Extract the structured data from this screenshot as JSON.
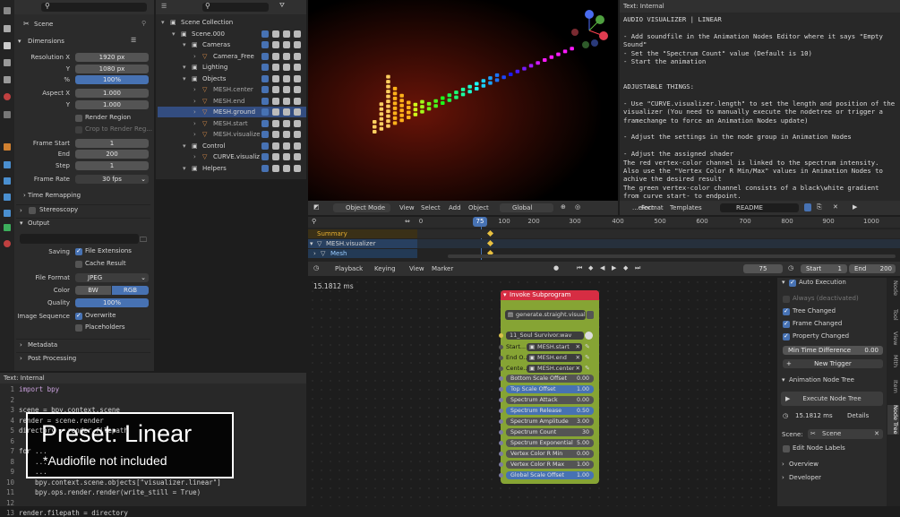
{
  "props": {
    "tab_title": "Scene",
    "dimensions": "Dimensions",
    "res_x_label": "Resolution X",
    "res_x": "1920 px",
    "res_y_label": "Y",
    "res_y": "1080 px",
    "pct_label": "%",
    "pct": "100%",
    "aspect_x_label": "Aspect X",
    "aspect_x": "1.000",
    "aspect_y_label": "Y",
    "aspect_y": "1.000",
    "render_region": "Render Region",
    "crop": "Crop to Render Reg...",
    "frame_start_label": "Frame Start",
    "frame_start": "1",
    "end_label": "End",
    "end": "200",
    "step_label": "Step",
    "step": "1",
    "frame_rate_label": "Frame Rate",
    "frame_rate": "30 fps",
    "time_remapping": "Time Remapping",
    "stereoscopy": "Stereoscopy",
    "output": "Output",
    "saving_label": "Saving",
    "file_ext": "File Extensions",
    "cache": "Cache Result",
    "file_format_label": "File Format",
    "file_format": "JPEG",
    "color_label": "Color",
    "bw": "BW",
    "rgb": "RGB",
    "quality_label": "Quality",
    "quality": "100%",
    "image_seq_label": "Image Sequence",
    "overwrite": "Overwrite",
    "placeholders": "Placeholders",
    "metadata": "Metadata",
    "post": "Post Processing"
  },
  "outliner": {
    "rows": [
      {
        "t": "Scene Collection",
        "i": 0
      },
      {
        "t": "Scene.000",
        "i": 1
      },
      {
        "t": "Cameras",
        "i": 2
      },
      {
        "t": "Camera_Free",
        "i": 3
      },
      {
        "t": "Lighting",
        "i": 2
      },
      {
        "t": "Objects",
        "i": 2
      },
      {
        "t": "MESH.center",
        "i": 3
      },
      {
        "t": "MESH.end",
        "i": 3
      },
      {
        "t": "MESH.ground",
        "i": 3
      },
      {
        "t": "MESH.start",
        "i": 3
      },
      {
        "t": "MESH.visualize",
        "i": 3
      },
      {
        "t": "Control",
        "i": 2
      },
      {
        "t": "CURVE.visualiz",
        "i": 3
      },
      {
        "t": "Helpers",
        "i": 2
      }
    ]
  },
  "textpanel": {
    "header": "Text: Internal",
    "lines": [
      "AUDIO VISUALIZER | LINEAR",
      "",
      "- Add soundfile in the Animation Nodes Editor where it says \"Empty",
      "Sound\"",
      "- Set the \"Spectrum Count\" value (Default is 10)",
      "- Start the animation",
      "",
      "",
      "ADJUSTABLE THINGS:",
      "",
      "- Use \"CURVE.visualizer.length\" to set the length and position of the",
      "visualizer (You need to manually execute the nodetree or trigger a",
      "framechange to force an Animation Nodes update)",
      "",
      "- Adjust the settings in the node group in Animation Nodes",
      "",
      "- Adjust the assigned shader",
      "The red vertex-color channel is linked to the spectrum intensity.",
      "Also use the \"Vertex Color R Min/Max\" values in Animation Nodes to",
      "achive the desired result",
      "The green vertex-color channel consists of a black\\white gradient",
      "from curve start- to endpoint."
    ],
    "menu": [
      "...elect",
      "Format",
      "Templates"
    ],
    "file": "README"
  },
  "viewport": {
    "mode": "Object Mode",
    "menu": [
      "View",
      "Select",
      "Add",
      "Object"
    ],
    "orient": "Global"
  },
  "timeline": {
    "ticks": [
      "0",
      "75",
      "100",
      "200",
      "300",
      "400",
      "500",
      "600",
      "700",
      "800",
      "900",
      "1000"
    ],
    "tracks": [
      "Summary",
      "MESH.visualizer",
      "Mesh"
    ],
    "menu": [
      "Playback",
      "Keying",
      "View",
      "Marker"
    ],
    "current": "75",
    "start_label": "Start",
    "start": "1",
    "end_label": "End",
    "end": "200"
  },
  "code": {
    "header": "Text: Internal",
    "lines": [
      {
        "n": "1",
        "t": "import bpy"
      },
      {
        "n": "2",
        "t": ""
      },
      {
        "n": "3",
        "t": "scene = bpy.context.scene"
      },
      {
        "n": "4",
        "t": "render = scene.render"
      },
      {
        "n": "5",
        "t": "directory = render.filepath"
      },
      {
        "n": "6",
        "t": ""
      },
      {
        "n": "7",
        "t": "for ..."
      },
      {
        "n": "8",
        "t": "    ..."
      },
      {
        "n": "9",
        "t": "    ..."
      },
      {
        "n": "10",
        "t": "    bpy.context.scene.objects[\"visualizer.linear\"]"
      },
      {
        "n": "11",
        "t": "    bpy.ops.render.render(write_still = True)"
      },
      {
        "n": "12",
        "t": ""
      },
      {
        "n": "13",
        "t": "render.filepath = directory"
      }
    ],
    "overlay_title": "Preset: Linear",
    "overlay_sub": "*Audiofile not included"
  },
  "node": {
    "time": "15.1812 ms",
    "title": "Invoke Subprogram",
    "sub": "generate.straight.visuali...",
    "sound": "11_Soul Survivor.wav",
    "objs": [
      {
        "l": "Start...",
        "v": "MESH.start"
      },
      {
        "l": "End O...",
        "v": "MESH.end"
      },
      {
        "l": "Cente...",
        "v": "MESH.center"
      }
    ],
    "params": [
      {
        "n": "Bottom Scale Offset",
        "v": "0.00"
      },
      {
        "n": "Top Scale Offset",
        "v": "1.00"
      },
      {
        "n": "Spectrum Attack",
        "v": "0.00"
      },
      {
        "n": "Spectrum Release",
        "v": "0.50"
      },
      {
        "n": "Spectrum Amplitude",
        "v": "3.00"
      },
      {
        "n": "Spectrum Count",
        "v": "30"
      },
      {
        "n": "Spectrum Exponential",
        "v": "5.00"
      },
      {
        "n": "Vertex Color R Min",
        "v": "0.00"
      },
      {
        "n": "Vertex Color R Max",
        "v": "1.00"
      },
      {
        "n": "Global Scale Offset",
        "v": "1.00"
      }
    ]
  },
  "sidebar": {
    "auto": "Auto Execution",
    "always": "Always (deactivated)",
    "tree": "Tree Changed",
    "frame": "Frame Changed",
    "property": "Property Changed",
    "mintime": "Min Time Difference",
    "mintime_v": "0.00",
    "trigger": "New Trigger",
    "tree_sec": "Animation Node Tree",
    "exec": "Execute Node Tree",
    "time": "15.1812 ms",
    "details": "Details",
    "scene_label": "Scene:",
    "scene": "Scene",
    "edit": "Edit Node Labels",
    "overview": "Overview",
    "developer": "Developer",
    "tabs": [
      "Node",
      "Tool",
      "View",
      "Mlth",
      "Item",
      "Node Tree"
    ]
  }
}
